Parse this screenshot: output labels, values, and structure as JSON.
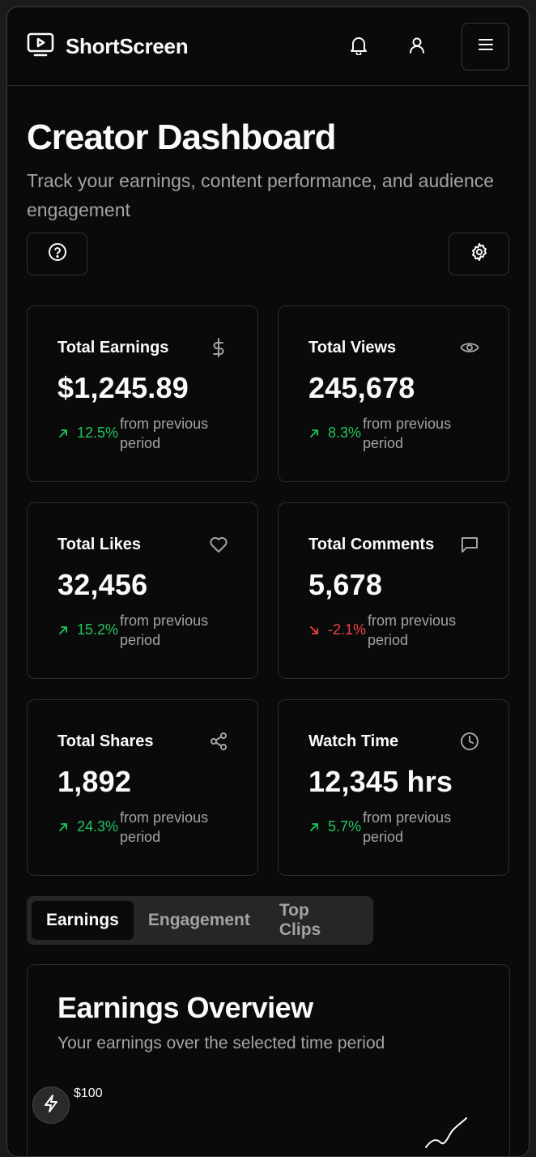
{
  "app": {
    "name": "ShortScreen"
  },
  "header": {
    "icons": [
      "bell-icon",
      "user-icon",
      "menu-icon"
    ]
  },
  "page": {
    "title": "Creator Dashboard",
    "subtitle": "Track your earnings, content performance, and audience engagement"
  },
  "stats": [
    {
      "label": "Total Earnings",
      "value": "$1,245.89",
      "change": "12.5%",
      "direction": "up",
      "note": "from previous period",
      "icon": "dollar-icon"
    },
    {
      "label": "Total Views",
      "value": "245,678",
      "change": "8.3%",
      "direction": "up",
      "note": "from previous period",
      "icon": "eye-icon"
    },
    {
      "label": "Total Likes",
      "value": "32,456",
      "change": "15.2%",
      "direction": "up",
      "note": "from previous period",
      "icon": "heart-icon"
    },
    {
      "label": "Total Comments",
      "value": "5,678",
      "change": "-2.1%",
      "direction": "down",
      "note": "from previous period",
      "icon": "message-icon"
    },
    {
      "label": "Total Shares",
      "value": "1,892",
      "change": "24.3%",
      "direction": "up",
      "note": "from previous period",
      "icon": "share-icon"
    },
    {
      "label": "Watch Time",
      "value": "12,345 hrs",
      "change": "5.7%",
      "direction": "up",
      "note": "from previous period",
      "icon": "clock-icon"
    }
  ],
  "tabs": [
    {
      "label": "Earnings",
      "active": true
    },
    {
      "label": "Engagement",
      "active": false
    },
    {
      "label": "Top Clips",
      "active": false
    }
  ],
  "overview": {
    "title": "Earnings Overview",
    "subtitle": "Your earnings over the selected time period",
    "y_tick": "$100"
  },
  "colors": {
    "background": "#0a0a0a",
    "positive": "#22c55e",
    "negative": "#ef4444",
    "muted": "#a3a3a3"
  }
}
